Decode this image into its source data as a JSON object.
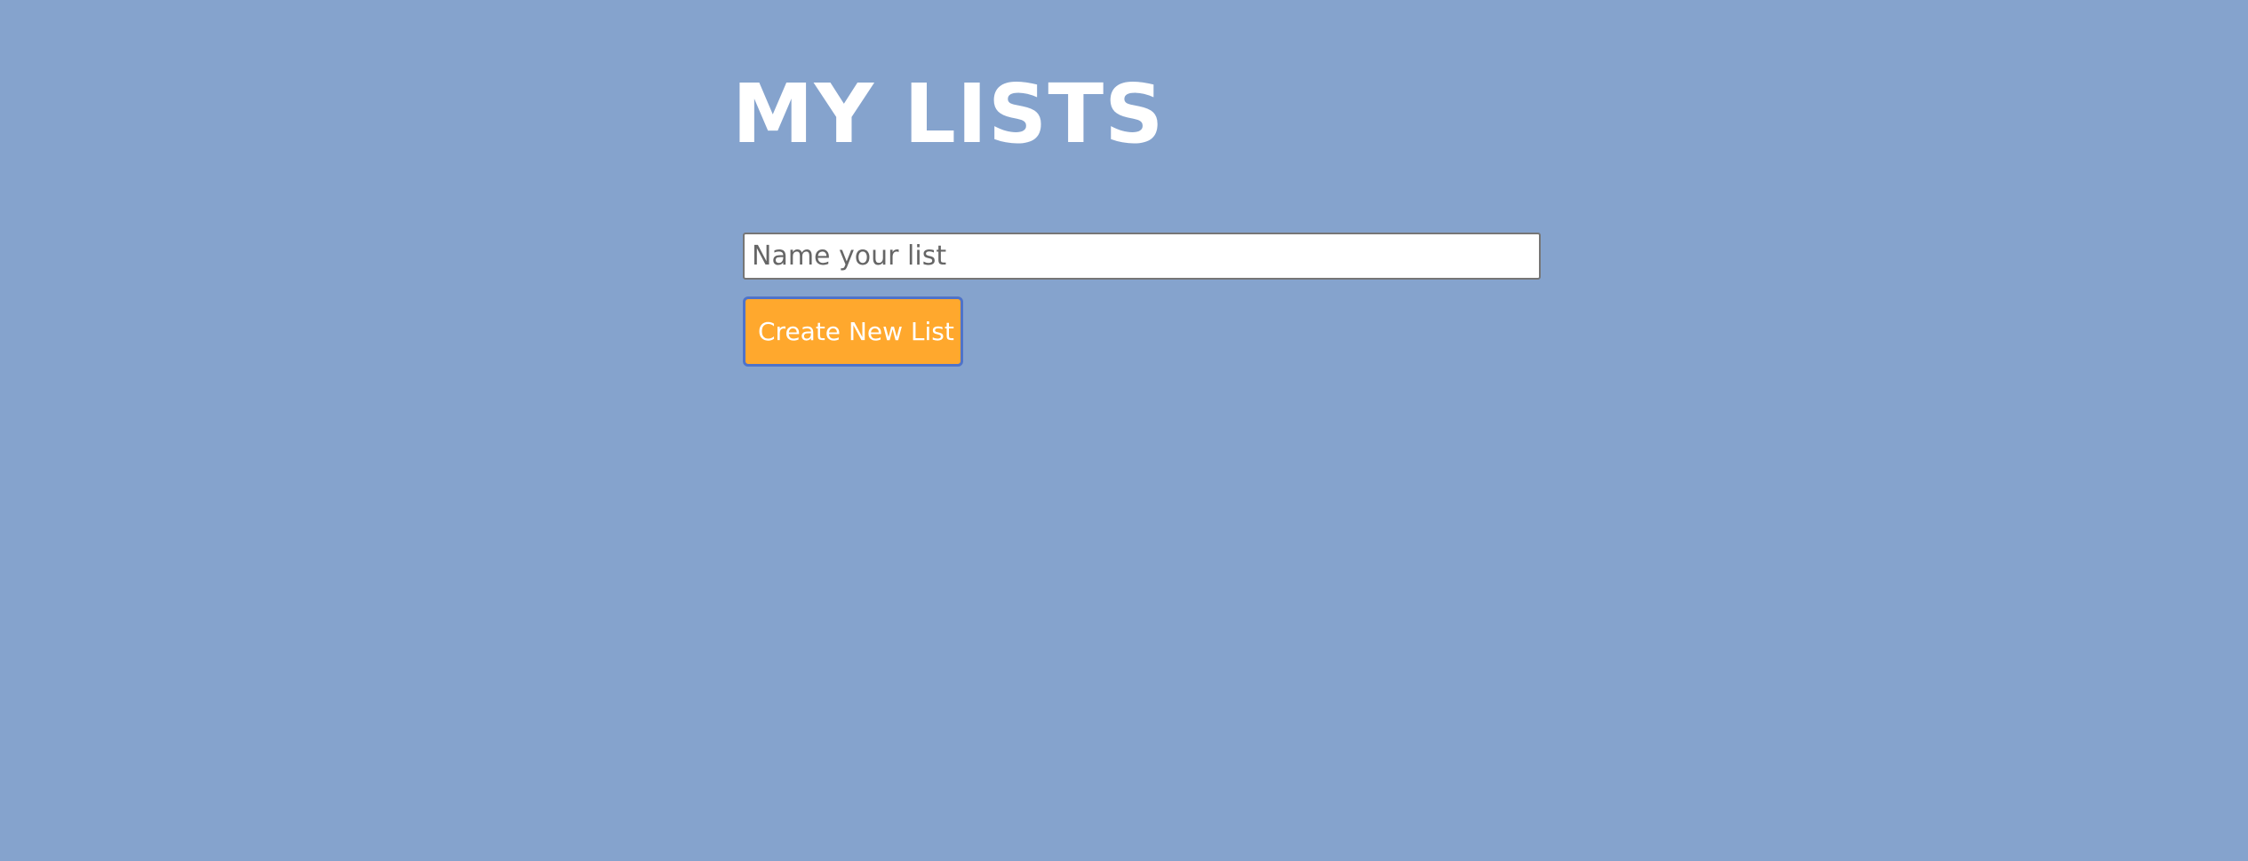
{
  "page": {
    "title": "MY LISTS",
    "background_color": "#85a3cd"
  },
  "list_form": {
    "name_input": {
      "value": "",
      "placeholder": "Name your list"
    },
    "create_button": {
      "label": "Create New List",
      "background_color": "#ffa82d",
      "border_color": "#4f73c9"
    }
  }
}
